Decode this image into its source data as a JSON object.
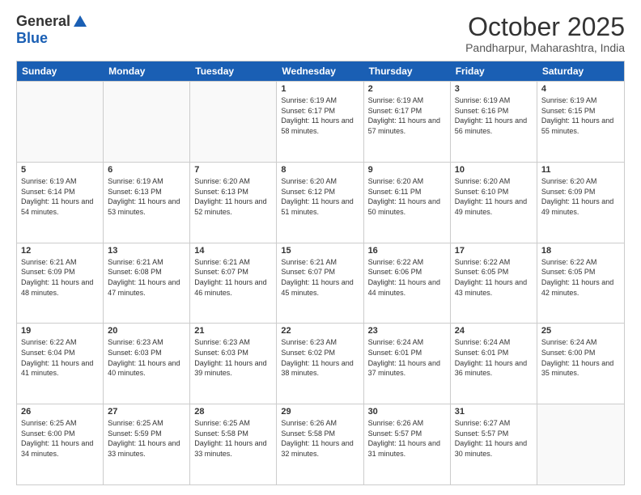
{
  "logo": {
    "general": "General",
    "blue": "Blue"
  },
  "header": {
    "month": "October 2025",
    "location": "Pandharpur, Maharashtra, India"
  },
  "weekdays": [
    "Sunday",
    "Monday",
    "Tuesday",
    "Wednesday",
    "Thursday",
    "Friday",
    "Saturday"
  ],
  "rows": [
    [
      {
        "day": "",
        "info": ""
      },
      {
        "day": "",
        "info": ""
      },
      {
        "day": "",
        "info": ""
      },
      {
        "day": "1",
        "info": "Sunrise: 6:19 AM\nSunset: 6:17 PM\nDaylight: 11 hours\nand 58 minutes."
      },
      {
        "day": "2",
        "info": "Sunrise: 6:19 AM\nSunset: 6:17 PM\nDaylight: 11 hours\nand 57 minutes."
      },
      {
        "day": "3",
        "info": "Sunrise: 6:19 AM\nSunset: 6:16 PM\nDaylight: 11 hours\nand 56 minutes."
      },
      {
        "day": "4",
        "info": "Sunrise: 6:19 AM\nSunset: 6:15 PM\nDaylight: 11 hours\nand 55 minutes."
      }
    ],
    [
      {
        "day": "5",
        "info": "Sunrise: 6:19 AM\nSunset: 6:14 PM\nDaylight: 11 hours\nand 54 minutes."
      },
      {
        "day": "6",
        "info": "Sunrise: 6:19 AM\nSunset: 6:13 PM\nDaylight: 11 hours\nand 53 minutes."
      },
      {
        "day": "7",
        "info": "Sunrise: 6:20 AM\nSunset: 6:13 PM\nDaylight: 11 hours\nand 52 minutes."
      },
      {
        "day": "8",
        "info": "Sunrise: 6:20 AM\nSunset: 6:12 PM\nDaylight: 11 hours\nand 51 minutes."
      },
      {
        "day": "9",
        "info": "Sunrise: 6:20 AM\nSunset: 6:11 PM\nDaylight: 11 hours\nand 50 minutes."
      },
      {
        "day": "10",
        "info": "Sunrise: 6:20 AM\nSunset: 6:10 PM\nDaylight: 11 hours\nand 49 minutes."
      },
      {
        "day": "11",
        "info": "Sunrise: 6:20 AM\nSunset: 6:09 PM\nDaylight: 11 hours\nand 49 minutes."
      }
    ],
    [
      {
        "day": "12",
        "info": "Sunrise: 6:21 AM\nSunset: 6:09 PM\nDaylight: 11 hours\nand 48 minutes."
      },
      {
        "day": "13",
        "info": "Sunrise: 6:21 AM\nSunset: 6:08 PM\nDaylight: 11 hours\nand 47 minutes."
      },
      {
        "day": "14",
        "info": "Sunrise: 6:21 AM\nSunset: 6:07 PM\nDaylight: 11 hours\nand 46 minutes."
      },
      {
        "day": "15",
        "info": "Sunrise: 6:21 AM\nSunset: 6:07 PM\nDaylight: 11 hours\nand 45 minutes."
      },
      {
        "day": "16",
        "info": "Sunrise: 6:22 AM\nSunset: 6:06 PM\nDaylight: 11 hours\nand 44 minutes."
      },
      {
        "day": "17",
        "info": "Sunrise: 6:22 AM\nSunset: 6:05 PM\nDaylight: 11 hours\nand 43 minutes."
      },
      {
        "day": "18",
        "info": "Sunrise: 6:22 AM\nSunset: 6:05 PM\nDaylight: 11 hours\nand 42 minutes."
      }
    ],
    [
      {
        "day": "19",
        "info": "Sunrise: 6:22 AM\nSunset: 6:04 PM\nDaylight: 11 hours\nand 41 minutes."
      },
      {
        "day": "20",
        "info": "Sunrise: 6:23 AM\nSunset: 6:03 PM\nDaylight: 11 hours\nand 40 minutes."
      },
      {
        "day": "21",
        "info": "Sunrise: 6:23 AM\nSunset: 6:03 PM\nDaylight: 11 hours\nand 39 minutes."
      },
      {
        "day": "22",
        "info": "Sunrise: 6:23 AM\nSunset: 6:02 PM\nDaylight: 11 hours\nand 38 minutes."
      },
      {
        "day": "23",
        "info": "Sunrise: 6:24 AM\nSunset: 6:01 PM\nDaylight: 11 hours\nand 37 minutes."
      },
      {
        "day": "24",
        "info": "Sunrise: 6:24 AM\nSunset: 6:01 PM\nDaylight: 11 hours\nand 36 minutes."
      },
      {
        "day": "25",
        "info": "Sunrise: 6:24 AM\nSunset: 6:00 PM\nDaylight: 11 hours\nand 35 minutes."
      }
    ],
    [
      {
        "day": "26",
        "info": "Sunrise: 6:25 AM\nSunset: 6:00 PM\nDaylight: 11 hours\nand 34 minutes."
      },
      {
        "day": "27",
        "info": "Sunrise: 6:25 AM\nSunset: 5:59 PM\nDaylight: 11 hours\nand 33 minutes."
      },
      {
        "day": "28",
        "info": "Sunrise: 6:25 AM\nSunset: 5:58 PM\nDaylight: 11 hours\nand 33 minutes."
      },
      {
        "day": "29",
        "info": "Sunrise: 6:26 AM\nSunset: 5:58 PM\nDaylight: 11 hours\nand 32 minutes."
      },
      {
        "day": "30",
        "info": "Sunrise: 6:26 AM\nSunset: 5:57 PM\nDaylight: 11 hours\nand 31 minutes."
      },
      {
        "day": "31",
        "info": "Sunrise: 6:27 AM\nSunset: 5:57 PM\nDaylight: 11 hours\nand 30 minutes."
      },
      {
        "day": "",
        "info": ""
      }
    ]
  ]
}
